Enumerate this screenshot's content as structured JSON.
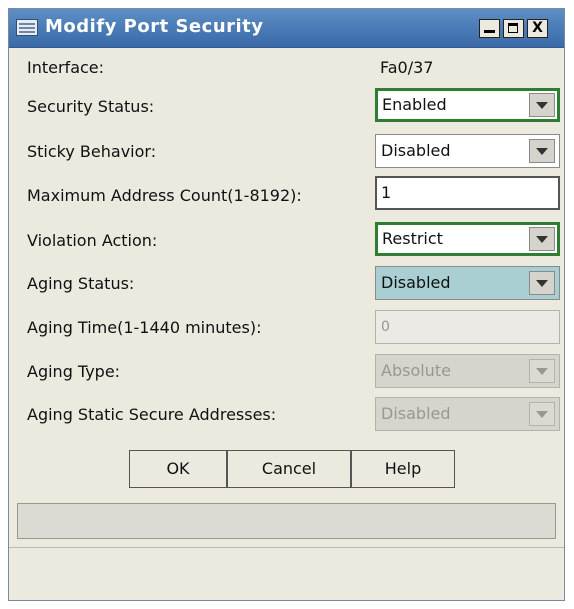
{
  "window": {
    "title": "Modify Port Security",
    "controls": {
      "minimize": "_",
      "maximize": "□",
      "close": "X"
    }
  },
  "form": {
    "interface": {
      "label": "Interface:",
      "value": "Fa0/37"
    },
    "security_status": {
      "label": "Security Status:",
      "value": "Enabled"
    },
    "sticky_behavior": {
      "label": "Sticky Behavior:",
      "value": "Disabled"
    },
    "max_address_count": {
      "label": "Maximum Address Count(1-8192):",
      "value": "1"
    },
    "violation_action": {
      "label": "Violation Action:",
      "value": "Restrict"
    },
    "aging_status": {
      "label": "Aging Status:",
      "value": "Disabled"
    },
    "aging_time": {
      "label": "Aging Time(1-1440 minutes):",
      "value": "0"
    },
    "aging_type": {
      "label": "Aging Type:",
      "value": "Absolute"
    },
    "aging_static": {
      "label": "Aging Static Secure Addresses:",
      "value": "Disabled"
    }
  },
  "buttons": {
    "ok": "OK",
    "cancel": "Cancel",
    "help": "Help"
  },
  "colors": {
    "titlebar": "#3a6aa8",
    "focus_border": "#2e7d32",
    "highlight": "#a9cfd2"
  }
}
